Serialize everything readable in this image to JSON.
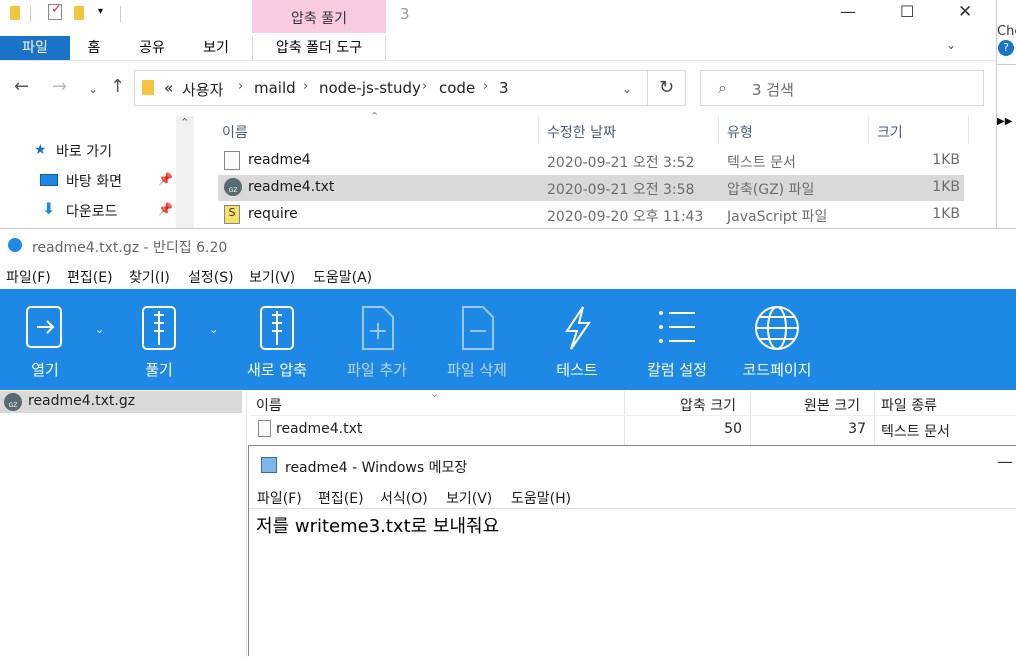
{
  "explorer": {
    "context_tab_title": "압축 풀기",
    "window_title": "3",
    "window_controls": {
      "minimize": "—",
      "maximize": "☐",
      "close": "✕"
    },
    "ribbon_tabs": [
      "파일",
      "홈",
      "공유",
      "보기",
      "압축 폴더 도구"
    ],
    "breadcrumbs": {
      "overflow": "«",
      "items": [
        "사용자",
        "maild",
        "node-js-study",
        "code",
        "3"
      ],
      "separator": "›"
    },
    "search_placeholder": "3 검색",
    "columns": [
      "이름",
      "수정한 날짜",
      "유형",
      "크기"
    ],
    "files": [
      {
        "name": "readme4",
        "date": "2020-09-21 오전 3:52",
        "type": "텍스트 문서",
        "size": "1KB",
        "icon": "text-file-icon",
        "selected": false
      },
      {
        "name": "readme4.txt",
        "date": "2020-09-21 오전 3:58",
        "type": "압축(GZ) 파일",
        "size": "1KB",
        "icon": "gz-archive-icon",
        "selected": true
      },
      {
        "name": "require",
        "date": "2020-09-20 오후 11:43",
        "type": "JavaScript 파일",
        "size": "1KB",
        "icon": "js-file-icon",
        "selected": false
      }
    ],
    "nav_pane": [
      {
        "label": "바로 가기",
        "icon": "star-icon"
      },
      {
        "label": "바탕 화면",
        "icon": "desktop-icon"
      },
      {
        "label": "다운로드",
        "icon": "download-icon"
      }
    ],
    "side_peek_text": "Che",
    "help_icon": "?",
    "more_icon": "▶▶"
  },
  "bandizip": {
    "title": "readme4.txt.gz - 반디집 6.20",
    "menu": [
      "파일(F)",
      "편집(E)",
      "찾기(I)",
      "설정(S)",
      "보기(V)",
      "도움말(A)"
    ],
    "toolbar": [
      {
        "label": "열기",
        "icon": "open-icon",
        "enabled": true,
        "dropdown": true
      },
      {
        "label": "풀기",
        "icon": "extract-icon",
        "enabled": true,
        "dropdown": true
      },
      {
        "label": "새로 압축",
        "icon": "new-archive-icon",
        "enabled": true,
        "dropdown": false
      },
      {
        "label": "파일 추가",
        "icon": "add-file-icon",
        "enabled": false,
        "dropdown": false
      },
      {
        "label": "파일 삭제",
        "icon": "delete-file-icon",
        "enabled": false,
        "dropdown": false
      },
      {
        "label": "테스트",
        "icon": "test-lightning-icon",
        "enabled": true,
        "dropdown": false
      },
      {
        "label": "칼럼 설정",
        "icon": "column-settings-icon",
        "enabled": true,
        "dropdown": false
      },
      {
        "label": "코드페이지",
        "icon": "codepage-globe-icon",
        "enabled": true,
        "dropdown": false
      }
    ],
    "tree_item": "readme4.txt.gz",
    "columns": [
      "이름",
      "압축 크기",
      "원본 크기",
      "파일 종류"
    ],
    "entries": [
      {
        "name": "readme4.txt",
        "packed": "50",
        "original": "37",
        "type": "텍스트 문서"
      }
    ],
    "accent": "#1e88e5"
  },
  "notepad": {
    "title": "readme4 - Windows 메모장",
    "menu": [
      "파일(F)",
      "편집(E)",
      "서식(O)",
      "보기(V)",
      "도움말(H)"
    ],
    "content": "저를 writeme3.txt로 보내줘요",
    "minimize": "—"
  }
}
